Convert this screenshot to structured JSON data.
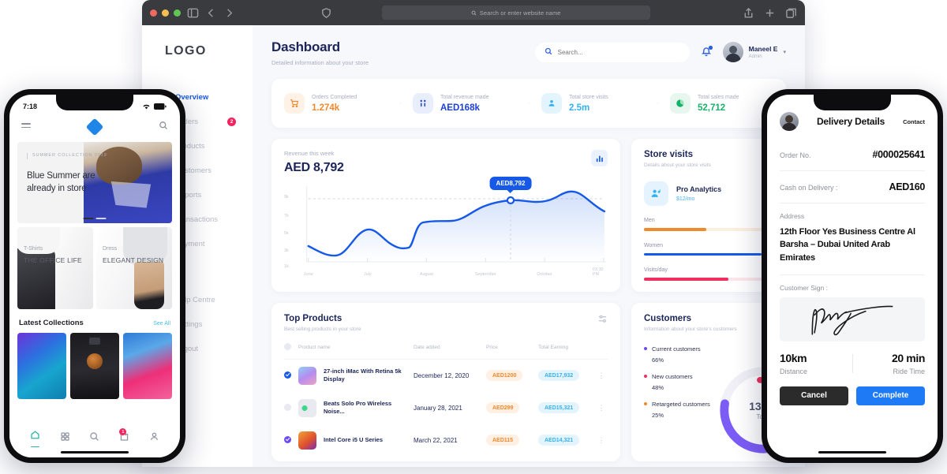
{
  "browser": {
    "url_placeholder": "Search or enter website name",
    "icons": [
      "sidebar-toggle-icon",
      "back-icon",
      "forward-icon",
      "shield-icon",
      "share-icon",
      "new-tab-icon",
      "tabs-icon"
    ]
  },
  "sidebar": {
    "logo": "LOGO",
    "items": [
      {
        "label": "Overview",
        "icon": "grid-icon",
        "active": true,
        "badge": ""
      },
      {
        "label": "Orders",
        "icon": "bag-icon",
        "active": false,
        "badge": "2"
      },
      {
        "label": "Products",
        "icon": "box-icon",
        "active": false,
        "badge": ""
      },
      {
        "label": "Customers",
        "icon": "users-icon",
        "active": false,
        "badge": ""
      },
      {
        "label": "Reports",
        "icon": "chart-icon",
        "active": false,
        "badge": ""
      },
      {
        "label": "Transactions",
        "icon": "card-icon",
        "active": false,
        "badge": ""
      },
      {
        "label": "Payment",
        "icon": "wallet-icon",
        "active": false,
        "badge": ""
      }
    ],
    "bottom_items": [
      {
        "label": "Help Centre",
        "icon": "help-icon"
      },
      {
        "label": "Settings",
        "icon": "gear-icon"
      },
      {
        "label": "Logout",
        "icon": "logout-icon"
      }
    ]
  },
  "header": {
    "title": "Dashboard",
    "subtitle": "Detailed information about your store",
    "search_placeholder": "Search...",
    "user_name": "Maneel E",
    "user_role": "Admin",
    "caret": "▾"
  },
  "stats": [
    {
      "label": "Orders Completed",
      "value": "1.274k",
      "icon": "cart-icon",
      "color": "#f0882c",
      "bg": "#fef2e6"
    },
    {
      "label": "Total revenue made",
      "value": "AED168k",
      "icon": "transfer-icon",
      "color": "#1b3fd8",
      "bg": "#e9eefd"
    },
    {
      "label": "Total store visits",
      "value": "2.5m",
      "icon": "user-icon",
      "color": "#35b0ef",
      "bg": "#e4f4fd"
    },
    {
      "label": "Total sales made",
      "value": "52,712",
      "icon": "pie-icon",
      "color": "#17b26a",
      "bg": "#e7f6ee"
    }
  ],
  "revenue": {
    "label": "Revenue this week",
    "amount": "AED 8,792",
    "tooltip": "AED8,792",
    "chart_icon": "bar-chart-icon"
  },
  "chart_data": {
    "type": "area",
    "title": "Revenue this week",
    "xlabel": "",
    "ylabel": "",
    "x": [
      "June",
      "July",
      "August",
      "September",
      "October",
      "03.30 PM"
    ],
    "categories": [
      "June",
      "July",
      "August",
      "September",
      "October",
      "03.30 PM"
    ],
    "yticks": [
      "1k",
      "3k",
      "5k",
      "7k",
      "9k"
    ],
    "ylim": [
      0,
      10000
    ],
    "grid": false,
    "legend": null,
    "highlight": {
      "label": "AED8,792",
      "x": "mid-October",
      "value": 8792
    },
    "series": [
      {
        "name": "Revenue",
        "color": "#1659e8",
        "values": [
          2900,
          2100,
          5600,
          4800,
          3200,
          6400,
          6500,
          7600,
          8600,
          8792,
          8400,
          8600,
          9400,
          8200,
          7500
        ]
      }
    ]
  },
  "store_visits": {
    "title": "Store visits",
    "subtitle": "Details about your store visits",
    "plan": {
      "name": "Pro Analytics",
      "price": "$12/mo",
      "icon": "users-analytics-icon"
    },
    "bars": [
      {
        "label": "Men",
        "percent": 48,
        "color": "#f0882c",
        "track": "#fdefe0"
      },
      {
        "label": "Women",
        "percent": 91,
        "color": "#1659e8",
        "track": "#e3eafd"
      },
      {
        "label": "Visits/day",
        "percent": 65,
        "color": "#ef2f5e",
        "track": "#fde6eb"
      }
    ]
  },
  "top_products": {
    "title": "Top Products",
    "subtitle": "Best selling products in your store",
    "filter_icon": "filter-icon",
    "columns": [
      "Product name",
      "Date added",
      "Price",
      "Total Earning"
    ],
    "rows": [
      {
        "checked": "on",
        "name": "27-inch iMac With Retina 5k Display",
        "date": "December 12, 2020",
        "price": "AED1200",
        "earning": "AED17,932",
        "thumb": "imac-thumb"
      },
      {
        "checked": "off",
        "name": "Beats Solo Pro Wireless Noise...",
        "date": "January 28, 2021",
        "price": "AED299",
        "earning": "AED15,321",
        "thumb": "beats-thumb"
      },
      {
        "checked": "alt",
        "name": "Intel Core i5 U Series",
        "date": "March 22, 2021",
        "price": "AED115",
        "earning": "AED14,321",
        "thumb": "intel-thumb"
      }
    ]
  },
  "customers": {
    "title": "Customers",
    "subtitle": "Information about your store's customers",
    "legend": [
      {
        "name": "Current customers",
        "value": "66%",
        "color": "#6c4bf4"
      },
      {
        "name": "New customers",
        "value": "48%",
        "color": "#ef2f5e"
      },
      {
        "name": "Retargeted customers",
        "value": "25%",
        "color": "#f0882c"
      }
    ],
    "donut": {
      "total": "139%",
      "total_label": "Total"
    }
  },
  "phone_left": {
    "status": {
      "time": "7:18",
      "wifi": "wifi-icon",
      "battery": "battery-icon"
    },
    "header": {
      "menu": "hamburger-icon",
      "logo": "diamond-logo-icon",
      "search": "search-icon"
    },
    "hero": {
      "kicker": "SUMMER COLLECTION 2019",
      "title": "Blue Summer are already in store"
    },
    "categories": [
      {
        "kicker": "T-Shirts",
        "name": "THE OFFICE LIFE"
      },
      {
        "kicker": "Dress",
        "name": "ELEGANT DESIGN"
      }
    ],
    "latest": {
      "title": "Latest Collections",
      "see_all": "See All"
    },
    "tabs": [
      {
        "icon": "home-icon",
        "active": true,
        "badge": ""
      },
      {
        "icon": "grid-icon",
        "active": false,
        "badge": ""
      },
      {
        "icon": "search-icon",
        "active": false,
        "badge": ""
      },
      {
        "icon": "cart-icon",
        "active": false,
        "badge": "1"
      },
      {
        "icon": "profile-icon",
        "active": false,
        "badge": ""
      }
    ]
  },
  "phone_right": {
    "title": "Delivery Details",
    "contact": "Contact",
    "avatar": "driver-avatar",
    "order_label": "Order No.",
    "order_value": "#000025641",
    "cash_label": "Cash on Delivery :",
    "cash_value": "AED160",
    "address_label": "Address",
    "address_value": "12th Floor Yes Business Centre Al Barsha – Dubai United Arab Emirates",
    "sign_label": "Customer Sign :",
    "metrics": [
      {
        "value": "10km",
        "label": "Distance"
      },
      {
        "value": "20 min",
        "label": "Ride Time"
      }
    ],
    "cancel": "Cancel",
    "complete": "Complete"
  }
}
